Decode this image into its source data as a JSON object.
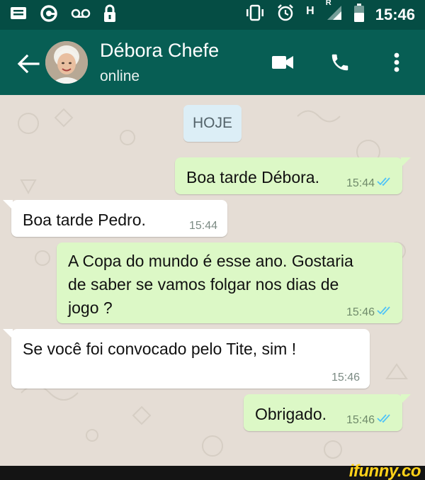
{
  "status_bar": {
    "time": "15:46",
    "network_label": "H",
    "roaming_label": "R",
    "icons": [
      "message-icon",
      "signal-app-icon",
      "voicemail-icon",
      "lock-icon",
      "vibrate-icon",
      "alarm-icon",
      "cell-signal-icon",
      "battery-icon"
    ]
  },
  "header": {
    "contact_name": "Débora Chefe",
    "status": "online",
    "icons": [
      "back-arrow-icon",
      "avatar",
      "video-call-icon",
      "phone-call-icon",
      "more-menu-icon"
    ]
  },
  "chat": {
    "date_chip": "HOJE",
    "messages": [
      {
        "direction": "outgoing",
        "text": "Boa tarde Débora.",
        "time": "15:44",
        "read": true
      },
      {
        "direction": "incoming",
        "text": "Boa tarde Pedro.",
        "time": "15:44"
      },
      {
        "direction": "outgoing",
        "text": "A Copa do mundo é esse ano. Gostaria\nde saber se vamos folgar nos dias de\njogo ?",
        "time": "15:46",
        "read": true
      },
      {
        "direction": "incoming",
        "text": "Se você foi convocado pelo Tite, sim !",
        "time": "15:46"
      },
      {
        "direction": "outgoing",
        "text": "Obrigado.",
        "time": "15:46",
        "read": true
      }
    ]
  },
  "watermark": "ifunny.co",
  "colors": {
    "status_bar": "#054d44",
    "app_bar": "#075e54",
    "wallpaper": "#e5ddd5",
    "outgoing_bubble": "#dcf8c6",
    "incoming_bubble": "#ffffff",
    "read_ticks": "#4fc3f7",
    "date_chip": "#dceef6"
  }
}
